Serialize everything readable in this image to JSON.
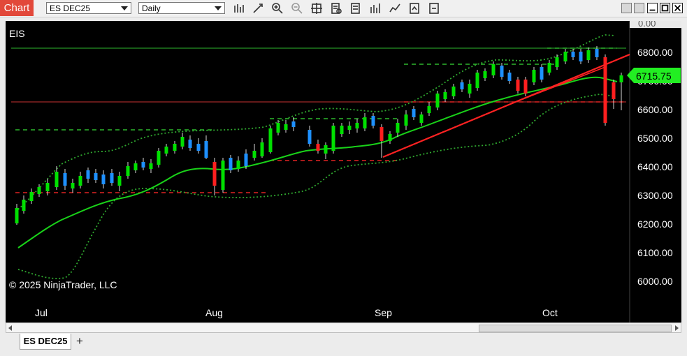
{
  "window": {
    "title": "Chart"
  },
  "toolbar": {
    "instrument": "ES DEC25",
    "interval": "Daily",
    "tools": [
      "bars-icon",
      "draw-icon",
      "zoom-in-icon",
      "zoom-out-icon",
      "crosshair-icon",
      "properties-icon",
      "strategies-icon",
      "indicators-icon",
      "drawing-tools-icon",
      "share-icon"
    ]
  },
  "chart": {
    "label": "EIS",
    "copyright": "© 2025 NinjaTrader, LLC",
    "x_axis_labels": [
      "Jul",
      "Aug",
      "Sep",
      "Oct"
    ],
    "y_axis_labels": [
      "0.00",
      "6800.00",
      "6700.00",
      "6600.00",
      "6500.00",
      "6400.00",
      "6300.00",
      "6200.00",
      "6100.00",
      "6000.00"
    ],
    "price_marker": "6715.75",
    "colors": {
      "up": "#00e000",
      "down": "#ff1f1f",
      "neutral_up": "#1e90ff",
      "ma": "#19d219",
      "band": "#2fa82f",
      "level_green": "#2eb82e",
      "level_red": "#e02222",
      "marker_bg": "#22ee22"
    }
  },
  "tabs": [
    {
      "label": "ES DEC25"
    }
  ],
  "add_tab_label": "+"
}
